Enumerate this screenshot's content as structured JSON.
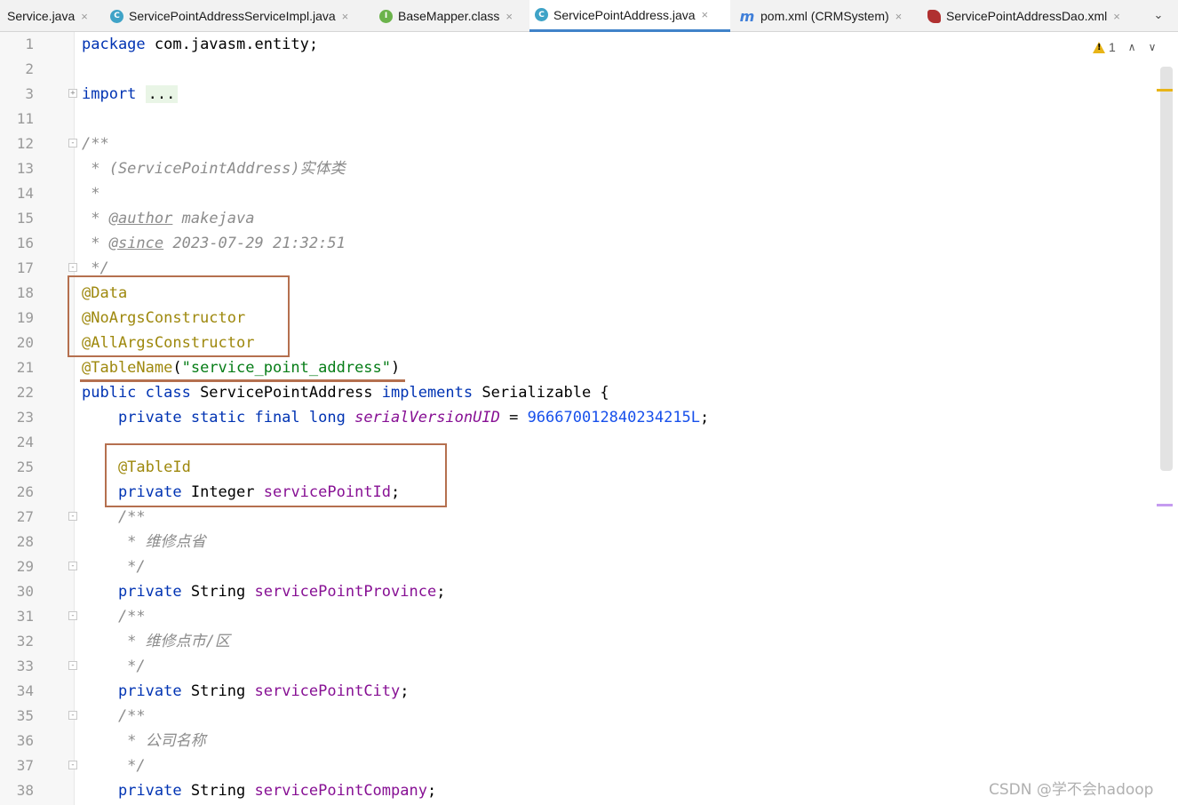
{
  "tabs": [
    {
      "label": "Service.java",
      "icon": "none",
      "active": false
    },
    {
      "label": "ServicePointAddressServiceImpl.java",
      "icon": "class-icon",
      "glyph": "C",
      "active": false
    },
    {
      "label": "BaseMapper.class",
      "icon": "interface-icon",
      "glyph": "I",
      "active": false
    },
    {
      "label": "ServicePointAddress.java",
      "icon": "class-icon",
      "glyph": "C",
      "active": true
    },
    {
      "label": "pom.xml (CRMSystem)",
      "icon": "maven-icon",
      "glyph": "m",
      "active": false
    },
    {
      "label": "ServicePointAddressDao.xml",
      "icon": "mybatis-icon",
      "glyph": "",
      "active": false
    }
  ],
  "tab_close_glyph": "×",
  "overflow_glyph": "⌄",
  "inspections": {
    "warning_count": "1"
  },
  "line_numbers": [
    "1",
    "2",
    "3",
    "11",
    "12",
    "13",
    "14",
    "15",
    "16",
    "17",
    "18",
    "19",
    "20",
    "21",
    "22",
    "23",
    "24",
    "25",
    "26",
    "27",
    "28",
    "29",
    "30",
    "31",
    "32",
    "33",
    "34",
    "35",
    "36",
    "37",
    "38"
  ],
  "code": {
    "l1_pkg_kw": "package",
    "l1_pkg_name": " com.javasm.entity;",
    "l3_import_kw": "import",
    "l3_folded": "...",
    "l12": "/**",
    "l13": " * (ServicePointAddress)实体类",
    "l14": " *",
    "l15_star": " * ",
    "l15_tag": "@author",
    "l15_text": " makejava",
    "l16_star": " * ",
    "l16_tag": "@since",
    "l16_text": " 2023-07-29 21:32:51",
    "l17": " */",
    "l18": "@Data",
    "l19": "@NoArgsConstructor",
    "l20": "@AllArgsConstructor",
    "l21_ann": "@TableName",
    "l21_open": "(",
    "l21_str": "\"service_point_address\"",
    "l21_close": ")",
    "l22_kw": "public class",
    "l22_name": " ServicePointAddress ",
    "l22_impl": "implements",
    "l22_rest": " Serializable {",
    "l23_indent": "    ",
    "l23_kw": "private static final long",
    "l23_field": "serialVersionUID",
    "l23_eq": " = ",
    "l23_num": "966670012840234215L",
    "l23_semi": ";",
    "l25": "    @TableId",
    "l26_indent": "    ",
    "l26_kw": "private",
    "l26_type": " Integer ",
    "l26_field": "servicePointId",
    "l26_semi": ";",
    "l27": "    /**",
    "l28": "     * 维修点省",
    "l29": "     */",
    "l30_indent": "    ",
    "l30_kw": "private",
    "l30_type": " String ",
    "l30_field": "servicePointProvince",
    "l30_semi": ";",
    "l31": "    /**",
    "l32": "     * 维修点市/区",
    "l33": "     */",
    "l34_indent": "    ",
    "l34_kw": "private",
    "l34_type": " String ",
    "l34_field": "servicePointCity",
    "l34_semi": ";",
    "l35": "    /**",
    "l36": "     * 公司名称",
    "l37": "     */",
    "l38_indent": "    ",
    "l38_kw": "private",
    "l38_type": " String ",
    "l38_field": "servicePointCompany",
    "l38_semi": ";"
  },
  "watermark": "CSDN @学不会hadoop",
  "colors": {
    "keyword": "#0033b3",
    "annotation": "#9e880d",
    "string": "#067d17",
    "number": "#1750eb",
    "field": "#871094",
    "comment": "#8c8c8c",
    "highlight_box": "#b5704f",
    "active_tab": "#4083c9"
  }
}
